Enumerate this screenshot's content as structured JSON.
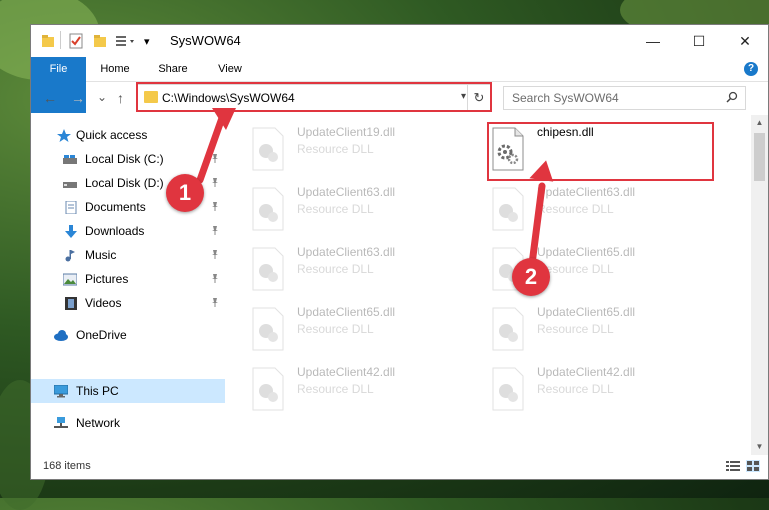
{
  "window": {
    "title": "SysWOW64",
    "minimize": "—",
    "maximize": "☐",
    "close": "✕"
  },
  "ribbon": {
    "tabs": [
      "File",
      "Home",
      "Share",
      "View"
    ],
    "help": "?"
  },
  "navbar": {
    "back": "←",
    "forward": "→",
    "recent": "⌄",
    "up": "↑",
    "address": "C:\\Windows\\SysWOW64",
    "refresh": "↻",
    "search_placeholder": "Search SysWOW64",
    "search_icon": "magnifier-icon"
  },
  "sidebar": {
    "items": [
      {
        "label": "Quick access",
        "icon": "star-icon",
        "pinned": false
      },
      {
        "label": "Local Disk (C:)",
        "icon": "drive-icon",
        "pinned": true
      },
      {
        "label": "Local Disk (D:)",
        "icon": "drive-icon",
        "pinned": true
      },
      {
        "label": "Documents",
        "icon": "documents-icon",
        "pinned": true
      },
      {
        "label": "Downloads",
        "icon": "download-arrow-icon",
        "pinned": true
      },
      {
        "label": "Music",
        "icon": "music-note-icon",
        "pinned": true
      },
      {
        "label": "Pictures",
        "icon": "pictures-icon",
        "pinned": true
      },
      {
        "label": "Videos",
        "icon": "film-icon",
        "pinned": true
      },
      {
        "label": "OneDrive",
        "icon": "cloud-icon",
        "pinned": false
      },
      {
        "label": "This PC",
        "icon": "monitor-icon",
        "pinned": false,
        "selected": true
      },
      {
        "label": "Network",
        "icon": "network-icon",
        "pinned": false
      }
    ],
    "pin_glyph": "📌"
  },
  "files": [
    {
      "name": "UpdateClient19.dll",
      "type": "Resource DLL",
      "faded": true
    },
    {
      "name": "chipesn.dll",
      "type": "",
      "faded": false,
      "highlighted": true
    },
    {
      "name": "UpdateClient63.dll",
      "type": "Resource DLL",
      "faded": true
    },
    {
      "name": "UpdateClient63.dll",
      "type": "Resource DLL",
      "faded": true
    },
    {
      "name": "UpdateClient63.dll",
      "type": "Resource DLL",
      "faded": true
    },
    {
      "name": "UpdateClient65.dll",
      "type": "Resource DLL",
      "faded": true
    },
    {
      "name": "UpdateClient65.dll",
      "type": "Resource DLL",
      "faded": true
    },
    {
      "name": "UpdateClient65.dll",
      "type": "Resource DLL",
      "faded": true
    },
    {
      "name": "UpdateClient42.dll",
      "type": "Resource DLL",
      "faded": true
    },
    {
      "name": "UpdateClient42.dll",
      "type": "Resource DLL",
      "faded": true
    }
  ],
  "status": {
    "item_count": "168 items"
  },
  "annotations": {
    "callout_1": "1",
    "callout_2": "2",
    "highlight_color": "#e0353f"
  },
  "colors": {
    "accent": "#1979ca",
    "selection": "#cce8ff",
    "folder": "#f4c94a"
  }
}
